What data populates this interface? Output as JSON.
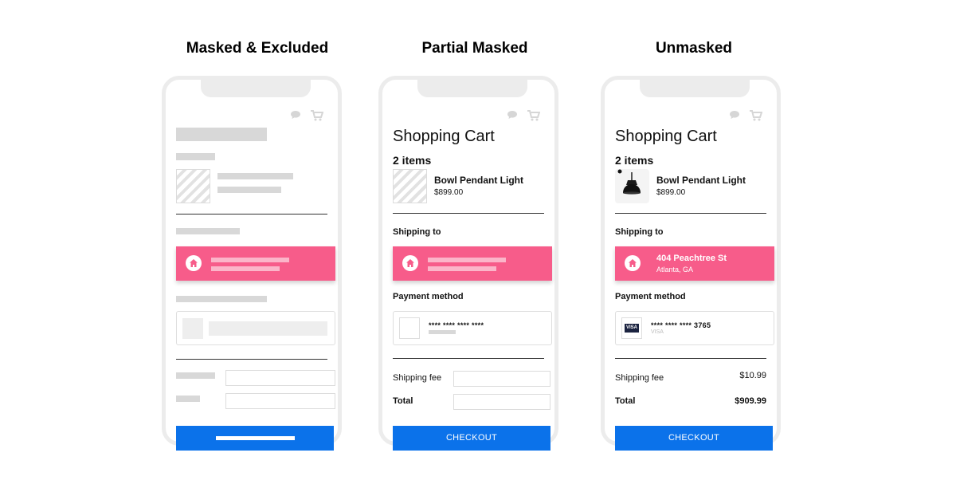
{
  "columns": [
    {
      "heading": "Masked & Excluded"
    },
    {
      "heading": "Partial Masked"
    },
    {
      "heading": "Unmasked"
    }
  ],
  "cart": {
    "title": "Shopping Cart",
    "item_count": "2 items",
    "product_name": "Bowl Pendant Light",
    "product_price": "$899.00",
    "shipping_label": "Shipping to",
    "address_line1": "404 Peachtree St",
    "address_line2": "Atlanta, GA",
    "payment_label": "Payment method",
    "card_masked_partial": "**** **** **** ****",
    "card_masked": "**** **** **** 3765",
    "card_brand": "VISA",
    "shipping_fee_label": "Shipping fee",
    "shipping_fee_value": "$10.99",
    "total_label": "Total",
    "total_value": "$909.99",
    "checkout_label": "CHECKOUT"
  },
  "icons": [
    "chat-icon",
    "cart-icon",
    "home-icon",
    "visa-card-icon",
    "pendant-lamp-icon"
  ],
  "colors": {
    "accent_pink": "#f75c8a",
    "checkout_blue": "#0b72ea",
    "frame_gray": "#ececec",
    "placeholder_gray": "#d8d8d8"
  }
}
